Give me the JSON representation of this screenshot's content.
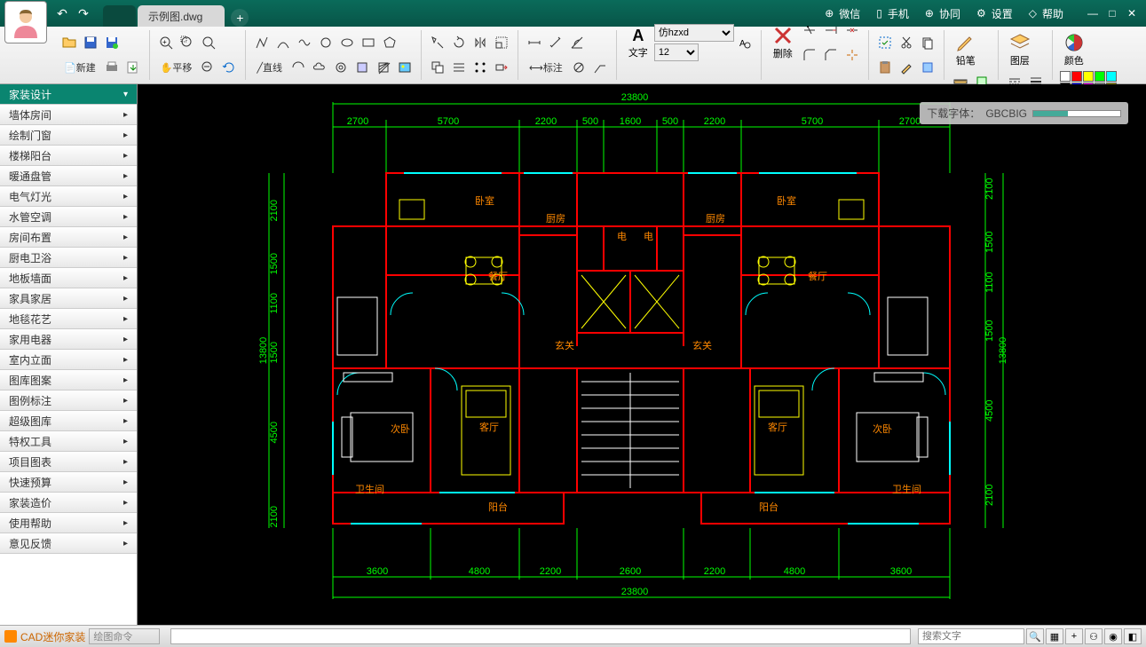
{
  "app": {
    "name": "CAD迷你家装"
  },
  "tabs": [
    {
      "label": "",
      "active": false
    },
    {
      "label": "示例图.dwg",
      "active": true
    }
  ],
  "title_right": [
    "微信",
    "手机",
    "协同",
    "设置",
    "帮助"
  ],
  "ribbon": {
    "file_new": "新建",
    "pan_label": "平移",
    "line_label": "直线",
    "annot_label": "标注",
    "text_label": "文字",
    "font_name": "仿hzxd",
    "font_size": "12",
    "delete_label": "删除",
    "pencil_label": "铅笔",
    "layer_label": "图层",
    "color_label": "颜色"
  },
  "sidebar": [
    "家装设计",
    "墙体房间",
    "绘制门窗",
    "楼梯阳台",
    "暖通盘管",
    "电气灯光",
    "水管空调",
    "房间布置",
    "厨电卫浴",
    "地板墙面",
    "家具家居",
    "地毯花艺",
    "家用电器",
    "室内立面",
    "图库图案",
    "图例标注",
    "超级图库",
    "特权工具",
    "项目图表",
    "快速预算",
    "家装造价",
    "使用帮助",
    "意见反馈"
  ],
  "drawing": {
    "overall_width": "23800",
    "top_dims": [
      "2700",
      "5700",
      "2200",
      "500",
      "1600",
      "500",
      "2200",
      "5700",
      "2700"
    ],
    "bottom_dims": [
      "3600",
      "4800",
      "2200",
      "2600",
      "2200",
      "4800",
      "3600"
    ],
    "left_v_dims": [
      "2100",
      "1500",
      "1100",
      "1500",
      "4500",
      "2100"
    ],
    "right_v_dims": [
      "2100",
      "1500",
      "1100",
      "1500",
      "4500",
      "2100"
    ],
    "left_total": "13800",
    "right_total": "13800",
    "rooms_left": {
      "bed1": "卧室",
      "dining": "餐厅",
      "kitchen": "厨房",
      "entry": "玄关",
      "living": "客厅",
      "bed2": "次卧",
      "balcony": "阳台",
      "bath_label": "卫生间"
    },
    "rooms_right": {
      "bed1": "卧室",
      "dining": "餐厅",
      "kitchen": "厨房",
      "entry": "玄关",
      "living": "客厅",
      "bed2": "次卧",
      "balcony": "阳台"
    },
    "elevator": "电"
  },
  "download": {
    "label": "下载字体：",
    "font": "GBCBIG"
  },
  "status": {
    "app_label": "CAD迷你家装",
    "cmd_label": "绘图命令",
    "search_placeholder": "搜索文字"
  },
  "colors": {
    "swatches": [
      "#ffffff",
      "#ff0000",
      "#ffff00",
      "#00ff00",
      "#00ffff",
      "#000000",
      "#0000ff",
      "#ff00ff",
      "#888888",
      "#808000"
    ]
  }
}
